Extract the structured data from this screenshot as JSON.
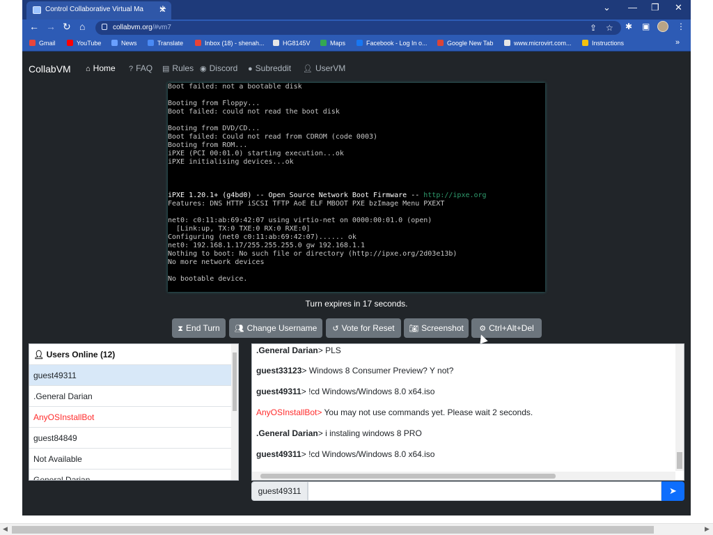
{
  "browser": {
    "tab_title": "Control Collaborative Virtual Ma",
    "url_host": "collabvm.org",
    "url_path": "/#vm7",
    "bookmarks": [
      {
        "label": "Gmail",
        "color": "#e8453c"
      },
      {
        "label": "YouTube",
        "color": "#ff0000"
      },
      {
        "label": "News",
        "color": "#6aa0ff"
      },
      {
        "label": "Translate",
        "color": "#4a8af4"
      },
      {
        "label": "Inbox (18) - shenah...",
        "color": "#ea4335"
      },
      {
        "label": "HG8145V",
        "color": "#e6e6e6"
      },
      {
        "label": "Maps",
        "color": "#34a853"
      },
      {
        "label": "Facebook - Log In o...",
        "color": "#1877f2"
      },
      {
        "label": "Google New Tab",
        "color": "#db4437"
      },
      {
        "label": "www.microvirt.com...",
        "color": "#e6e6e6"
      },
      {
        "label": "Instructions",
        "color": "#f4c20d"
      }
    ]
  },
  "nav": {
    "brand": "CollabVM",
    "links": [
      {
        "label": "Home",
        "icon": "home-icon"
      },
      {
        "label": "FAQ",
        "icon": "question-circle-icon"
      },
      {
        "label": "Rules",
        "icon": "clipboard-icon"
      },
      {
        "label": "Discord",
        "icon": "discord-icon"
      },
      {
        "label": "Subreddit",
        "icon": "reddit-icon"
      },
      {
        "label": "UserVM",
        "icon": "user-icon"
      }
    ]
  },
  "vm": {
    "lines": [
      "Boot failed: not a bootable disk",
      "",
      "Booting from Floppy...",
      "Boot failed: could not read the boot disk",
      "",
      "Booting from DVD/CD...",
      "Boot failed: Could not read from CDROM (code 0003)",
      "Booting from ROM...",
      "iPXE (PCI 00:01.0) starting execution...ok",
      "iPXE initialising devices...ok",
      "",
      "",
      "",
      "iPXE 1.20.1+ (g4bd0) -- Open Source Network Boot Firmware -- http://ipxe.org",
      "Features: DNS HTTP iSCSI TFTP AoE ELF MBOOT PXE bzImage Menu PXEXT",
      "",
      "net0: c0:11:ab:69:42:07 using virtio-net on 0000:00:01.0 (open)",
      "  [Link:up, TX:0 TXE:0 RX:0 RXE:0]",
      "Configuring (net0 c0:11:ab:69:42:07)...... ok",
      "net0: 192.168.1.17/255.255.255.0 gw 192.168.1.1",
      "Nothing to boot: No such file or directory (http://ipxe.org/2d03e13b)",
      "No more network devices",
      "",
      "No bootable device."
    ],
    "turn_text": "Turn expires in 17 seconds."
  },
  "actions": [
    {
      "label": "End Turn",
      "icon": "hourglass-icon"
    },
    {
      "label": "Change Username",
      "icon": "users-icon"
    },
    {
      "label": "Vote for Reset",
      "icon": "reset-icon"
    },
    {
      "label": "Screenshot",
      "icon": "camera-icon"
    },
    {
      "label": "Ctrl+Alt+Del",
      "icon": "gear-icon"
    }
  ],
  "users": {
    "header": "Users Online (12)",
    "list": [
      "guest49311",
      ".General Darian",
      "AnyOSInstallBot",
      "guest84849",
      "Not Available",
      "General Darian"
    ]
  },
  "chat": {
    "messages": [
      {
        "user": ".General Darian",
        "text": "PLS"
      },
      {
        "user": "guest33123",
        "text": "Windows 8 Consumer Preview? Y not?"
      },
      {
        "user": "guest49311",
        "text": "!cd Windows/Windows 8.0 x64.iso"
      },
      {
        "user": "AnyOSInstallBot",
        "text": "You may not use commands yet. Please wait 2 seconds."
      },
      {
        "user": ".General Darian",
        "text": "i instaling windows 8 PRO"
      },
      {
        "user": "guest49311",
        "text": "!cd Windows/Windows 8.0 x64.iso"
      }
    ],
    "username": "guest49311",
    "input_value": "",
    "input_placeholder": ""
  }
}
